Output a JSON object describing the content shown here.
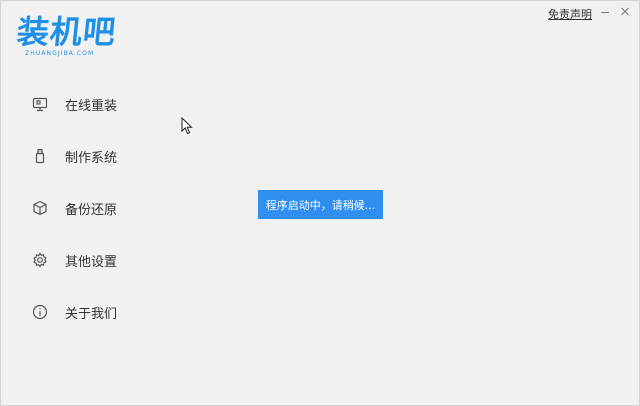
{
  "logo": {
    "main": "装机吧",
    "sub": "ZHUANGJIBA.COM"
  },
  "header": {
    "disclaimer": "免责声明"
  },
  "menu": {
    "items": [
      {
        "label": "在线重装",
        "icon": "monitor-icon"
      },
      {
        "label": "制作系统",
        "icon": "usb-icon"
      },
      {
        "label": "备份还原",
        "icon": "cube-icon"
      },
      {
        "label": "其他设置",
        "icon": "gear-icon"
      },
      {
        "label": "关于我们",
        "icon": "info-icon"
      }
    ]
  },
  "toast": {
    "text": "程序启动中，请稍候..."
  },
  "colors": {
    "brand": "#1f8fe6",
    "toast_bg": "#2f8ef0",
    "window_bg": "#f1f1f2"
  }
}
